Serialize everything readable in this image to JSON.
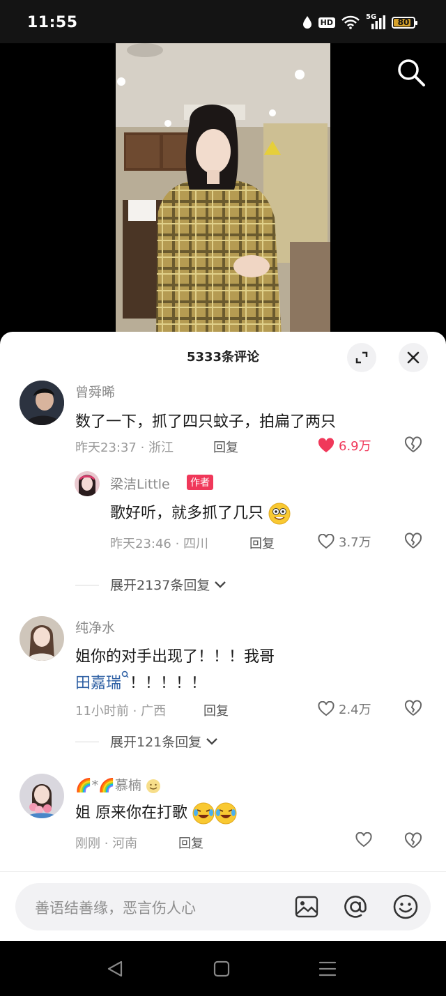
{
  "status_bar": {
    "time": "11:55",
    "network": "5G",
    "hd": "HD",
    "battery": "80"
  },
  "comments_sheet": {
    "title": "5333条评论",
    "comments": [
      {
        "user": "曾舜晞",
        "text": "数了一下，抓了四只蚊子，拍扁了两只",
        "time_location": "昨天23:37 · 浙江",
        "reply_label": "回复",
        "likes": "6.9万"
      },
      {
        "user": "梁洁Little",
        "badge": "作者",
        "text": "歌好听，就多抓了几只",
        "time_location": "昨天23:46 · 四川",
        "reply_label": "回复",
        "likes": "3.7万"
      },
      {
        "expand_label": "展开2137条回复"
      },
      {
        "user": "纯净水",
        "text_line1": "姐你的对手出现了！！！我哥",
        "mention": "田嘉瑞",
        "text_line2_rest": "！！！！！",
        "time_location": "11小时前 · 广西",
        "reply_label": "回复",
        "likes": "2.4万"
      },
      {
        "expand_label": "展开121条回复"
      },
      {
        "user": "🌈*🌈慕楠",
        "text": "姐 原来你在打歌",
        "time_location": "刚刚 · 河南",
        "reply_label": "回复",
        "likes": ""
      }
    ]
  },
  "input": {
    "placeholder": "善语结善缘，恶言伤人心"
  },
  "icons": {
    "accent": "#f0385a"
  }
}
